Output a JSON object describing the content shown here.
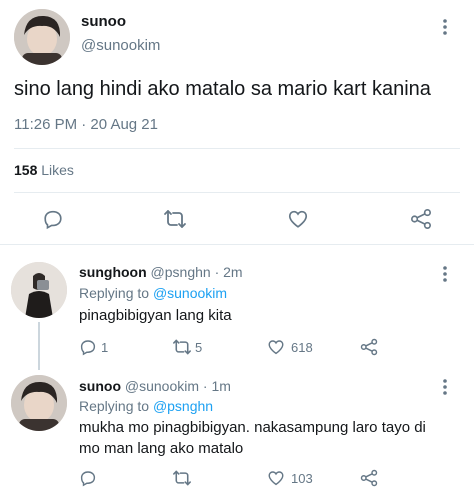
{
  "main_tweet": {
    "display_name": "sunoo",
    "handle": "@sunookim",
    "text": "sino lang hindi ako matalo sa mario kart kanina",
    "timestamp": "11:26 PM · 20 Aug 21",
    "likes_count": "158",
    "likes_label": "Likes"
  },
  "replies": [
    {
      "display_name": "sunghoon",
      "handle_time": "@psnghn · 2m",
      "replying_label": "Replying to",
      "replying_to": "@sunookim",
      "text": "pinagbibigyan lang kita",
      "reply_count": "1",
      "retweet_count": "5",
      "like_count": "618"
    },
    {
      "display_name": "sunoo",
      "handle_time": "@sunookim · 1m",
      "replying_label": "Replying to",
      "replying_to": "@psnghn",
      "text_line1": "mukha mo pinagbibigyan. nakasampung laro tayo di",
      "text_line2": "mo man lang ako matalo",
      "reply_count": "",
      "retweet_count": "",
      "like_count": "103"
    }
  ],
  "colors": {
    "accent": "#1da1f2",
    "muted": "#657786",
    "divider": "#e6ecf0"
  },
  "icons": [
    "more-dots-icon",
    "reply-icon",
    "retweet-icon",
    "like-icon",
    "share-icon"
  ]
}
